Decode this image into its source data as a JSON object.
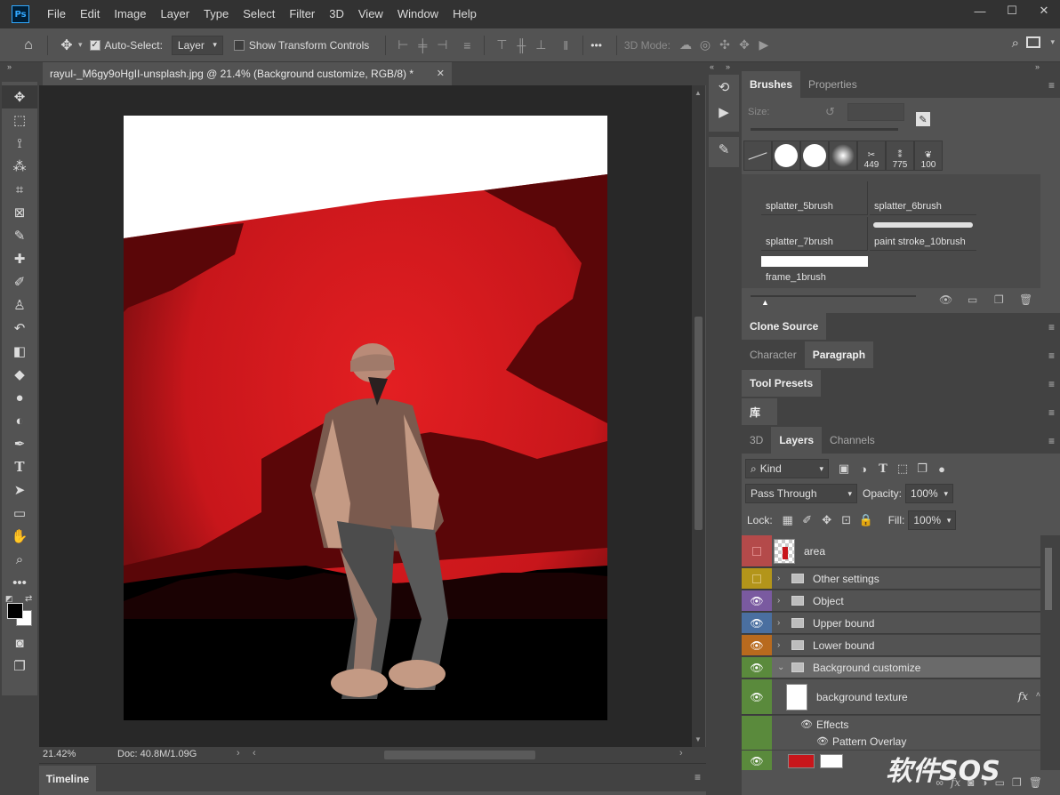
{
  "menu": {
    "logo": "Ps",
    "items": [
      "File",
      "Edit",
      "Image",
      "Layer",
      "Type",
      "Select",
      "Filter",
      "3D",
      "View",
      "Window",
      "Help"
    ],
    "window_controls": [
      "minimize",
      "maximize",
      "close"
    ]
  },
  "options_bar": {
    "auto_select_label": "Auto-Select:",
    "auto_select_checked": true,
    "auto_select_target": "Layer",
    "show_transform_label": "Show Transform Controls",
    "show_transform_checked": false,
    "more_label": "•••",
    "mode_label": "3D Mode:"
  },
  "document": {
    "tab_title": "rayul-_M6gy9oHgII-unsplash.jpg @ 21.4% (Background customize, RGB/8) *",
    "zoom": "21.42%",
    "doc_info": "Doc: 40.8M/1.09G"
  },
  "timeline": {
    "label": "Timeline"
  },
  "brushes_panel": {
    "tabs": [
      "Brushes",
      "Properties"
    ],
    "active_tab": "Brushes",
    "size_label": "Size:",
    "presets": [
      "449",
      "775",
      "100"
    ],
    "brushes": [
      "splatter_5brush",
      "splatter_6brush",
      "splatter_7brush",
      "paint stroke_10brush",
      "frame_1brush"
    ]
  },
  "collapsed_panels": {
    "clone_source": "Clone Source",
    "char_tabs": [
      "Character",
      "Paragraph"
    ],
    "tool_presets": "Tool Presets",
    "library": "库"
  },
  "layers_panel": {
    "tabs": [
      "3D",
      "Layers",
      "Channels"
    ],
    "active_tab": "Layers",
    "filter_kind": "Kind",
    "blend_mode": "Pass Through",
    "opacity_label": "Opacity:",
    "opacity_value": "100%",
    "lock_label": "Lock:",
    "fill_label": "Fill:",
    "fill_value": "100%",
    "layers": [
      {
        "name": "area",
        "color": "#b44a4a",
        "type": "layer",
        "visible": false
      },
      {
        "name": "Other settings",
        "color": "#b3951a",
        "type": "group",
        "visible": false
      },
      {
        "name": "Object",
        "color": "#7a5aa0",
        "type": "group",
        "visible": true
      },
      {
        "name": "Upper bound",
        "color": "#4a6fa0",
        "type": "group",
        "visible": true
      },
      {
        "name": "Lower bound",
        "color": "#b86a1e",
        "type": "group",
        "visible": true
      },
      {
        "name": "Background customize",
        "color": "#5a8a3c",
        "type": "group",
        "visible": true
      },
      {
        "name": "background texture",
        "color": "#5a8a3c",
        "type": "layer",
        "visible": true
      },
      {
        "name": "Effects",
        "color": "#5a8a3c",
        "type": "effects",
        "visible": true
      },
      {
        "name": "Pattern Overlay",
        "color": "#5a8a3c",
        "type": "effect",
        "visible": true
      }
    ],
    "fx_label": "fx"
  },
  "watermark": {
    "text": "软件SOS"
  },
  "colors": {
    "accent_red": "#c8161b",
    "panel_bg": "#535353",
    "dark_bg": "#424242",
    "canvas_bg": "#282828"
  }
}
